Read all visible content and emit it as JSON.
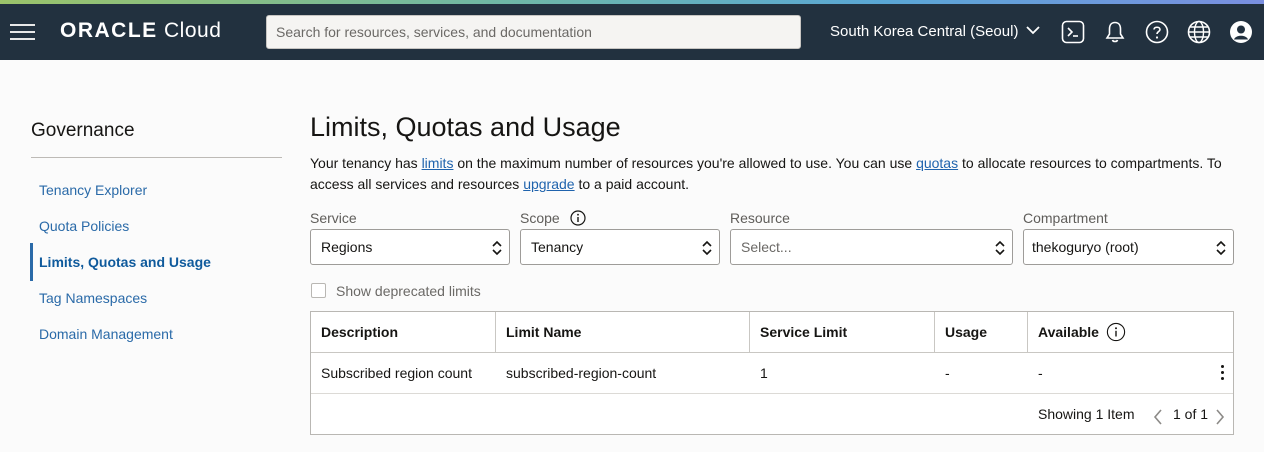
{
  "header": {
    "logo_bold": "ORACLE",
    "logo_light": "Cloud",
    "search_placeholder": "Search for resources, services, and documentation",
    "region": "South Korea Central (Seoul)",
    "icons": [
      "menu-icon",
      "cloud-shell-icon",
      "bell-icon",
      "help-icon",
      "globe-icon",
      "profile-icon"
    ]
  },
  "sidebar": {
    "title": "Governance",
    "items": [
      {
        "label": "Tenancy Explorer",
        "active": false
      },
      {
        "label": "Quota Policies",
        "active": false
      },
      {
        "label": "Limits, Quotas and Usage",
        "active": true
      },
      {
        "label": "Tag Namespaces",
        "active": false
      },
      {
        "label": "Domain Management",
        "active": false
      }
    ]
  },
  "main": {
    "title": "Limits, Quotas and Usage",
    "description": {
      "part1": "Your tenancy has ",
      "link1": "limits",
      "part2": " on the maximum number of resources you're allowed to use. You can use ",
      "link2": "quotas",
      "part3": " to allocate resources to compartments. To access all services and resources ",
      "link3": "upgrade",
      "part4": " to a paid account."
    },
    "filters": {
      "service": {
        "label": "Service",
        "value": "Regions"
      },
      "scope": {
        "label": "Scope",
        "value": "Tenancy"
      },
      "resource": {
        "label": "Resource",
        "placeholder": "Select..."
      },
      "compartment": {
        "label": "Compartment",
        "value": "thekoguryo (root)"
      }
    },
    "show_deprecated": {
      "label": "Show deprecated limits",
      "checked": false
    },
    "table": {
      "columns": [
        "Description",
        "Limit Name",
        "Service Limit",
        "Usage",
        "Available"
      ],
      "rows": [
        [
          "Subscribed region count",
          "subscribed-region-count",
          "1",
          "-",
          "-"
        ]
      ],
      "showing": "Showing 1 Item",
      "page": "1 of 1"
    }
  },
  "colors": {
    "topbar": "#22313f",
    "link": "#1f63ad",
    "active_nav": "#2a6aa8"
  }
}
